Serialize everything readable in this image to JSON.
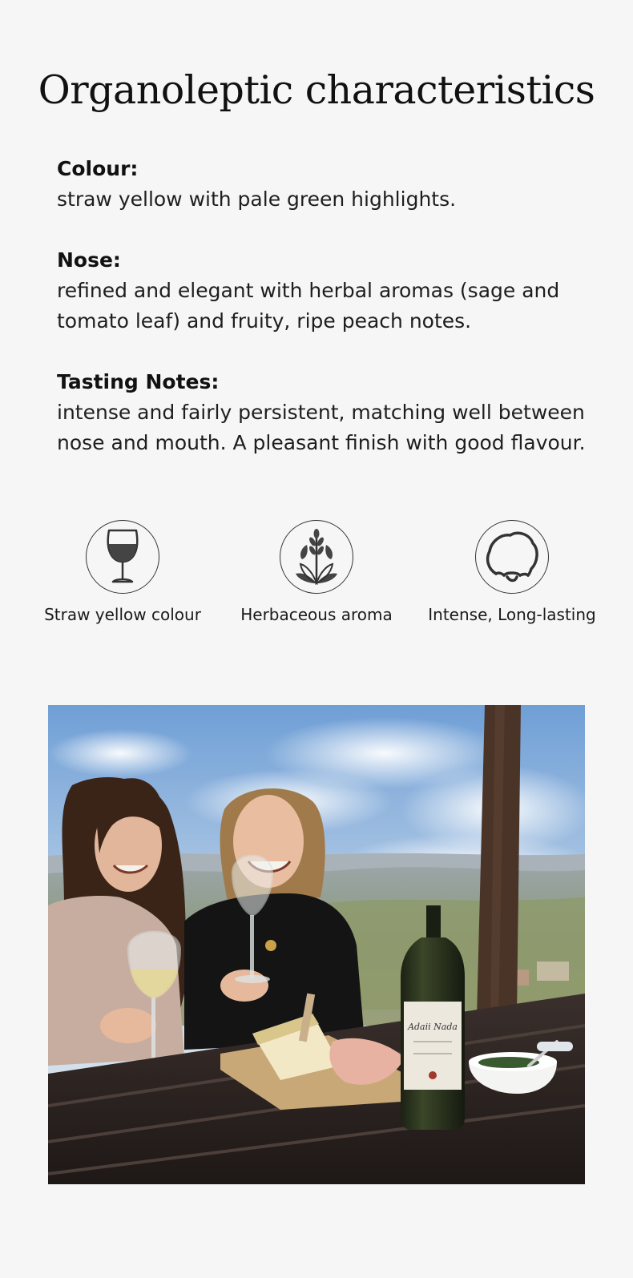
{
  "title": "Organoleptic characteristics",
  "characteristics": [
    {
      "label": "Colour:",
      "text": "straw yellow with pale green highlights."
    },
    {
      "label": "Nose:",
      "text": "refined and elegant with herbal aromas (sage and tomato leaf) and fruity, ripe peach notes."
    },
    {
      "label": "Tasting Notes:",
      "text": "intense and fairly persistent, matching well between nose and mouth. A pleasant finish with good flavour."
    }
  ],
  "features": [
    {
      "icon": "wine-glass-icon",
      "label": "Straw yellow colour"
    },
    {
      "icon": "herb-sprig-icon",
      "label": "Herbaceous aroma"
    },
    {
      "icon": "palate-cloud-icon",
      "label": "Intense, Long-lasting"
    }
  ],
  "photo": {
    "description": "two-women-toasting-wine-outdoors",
    "bottle_label": "Adaii Nada"
  }
}
